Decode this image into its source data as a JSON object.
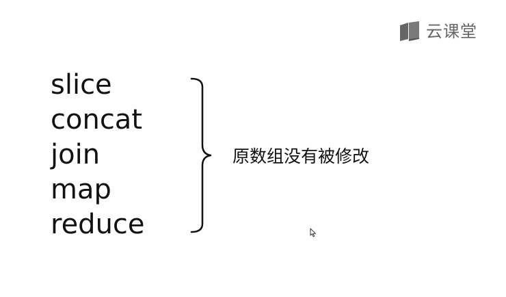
{
  "logo": {
    "text": "云课堂",
    "icon": "book-icon"
  },
  "methods": [
    "slice",
    "concat",
    "join",
    "map",
    "reduce"
  ],
  "note": "原数组没有被修改",
  "colors": {
    "text": "#111111",
    "logo": "#666666"
  }
}
